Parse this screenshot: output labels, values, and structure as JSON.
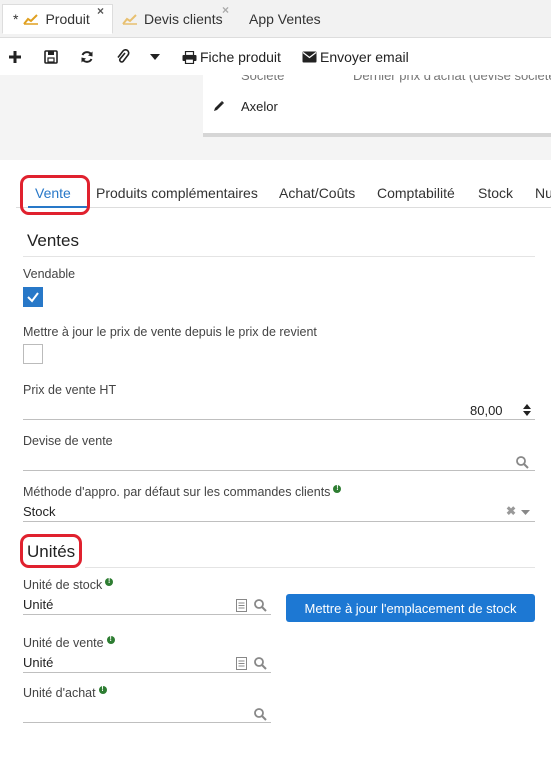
{
  "tabs": [
    {
      "prefix": "*",
      "label": "Produit",
      "close": "×"
    },
    {
      "label": "Devis clients",
      "close": "×"
    },
    {
      "label": "App Ventes"
    }
  ],
  "toolbar": {
    "print_label": "Fiche produit",
    "email_label": "Envoyer email"
  },
  "subtable": {
    "col1": "Société",
    "col2": "Dernier prix d'achat (devise société)",
    "row_company": "Axelor"
  },
  "form_tabs": [
    "Vente",
    "Produits complémentaires",
    "Achat/Coûts",
    "Comptabilité",
    "Stock",
    "Nu"
  ],
  "ventes": {
    "title": "Ventes",
    "sellable_label": "Vendable",
    "sellable_checked": true,
    "update_price_label": "Mettre à jour le prix de vente depuis le prix de revient",
    "update_price_checked": false,
    "price_label": "Prix de vente HT",
    "price_value": "80,00",
    "currency_label": "Devise de vente",
    "currency_value": "",
    "supply_method_label": "Méthode d'appro. par défaut sur les commandes clients",
    "supply_method_value": "Stock"
  },
  "unites": {
    "title": "Unités",
    "stock_unit_label": "Unité de stock",
    "stock_unit_value": "Unité",
    "sale_unit_label": "Unité de vente",
    "sale_unit_value": "Unité",
    "purchase_unit_label": "Unité d'achat",
    "purchase_unit_value": "",
    "update_location_button": "Mettre à jour l'emplacement de stock"
  },
  "colors": {
    "accent": "#2878c8",
    "button": "#1d78d3",
    "highlight": "#e0212e",
    "info": "#2e7d32"
  }
}
